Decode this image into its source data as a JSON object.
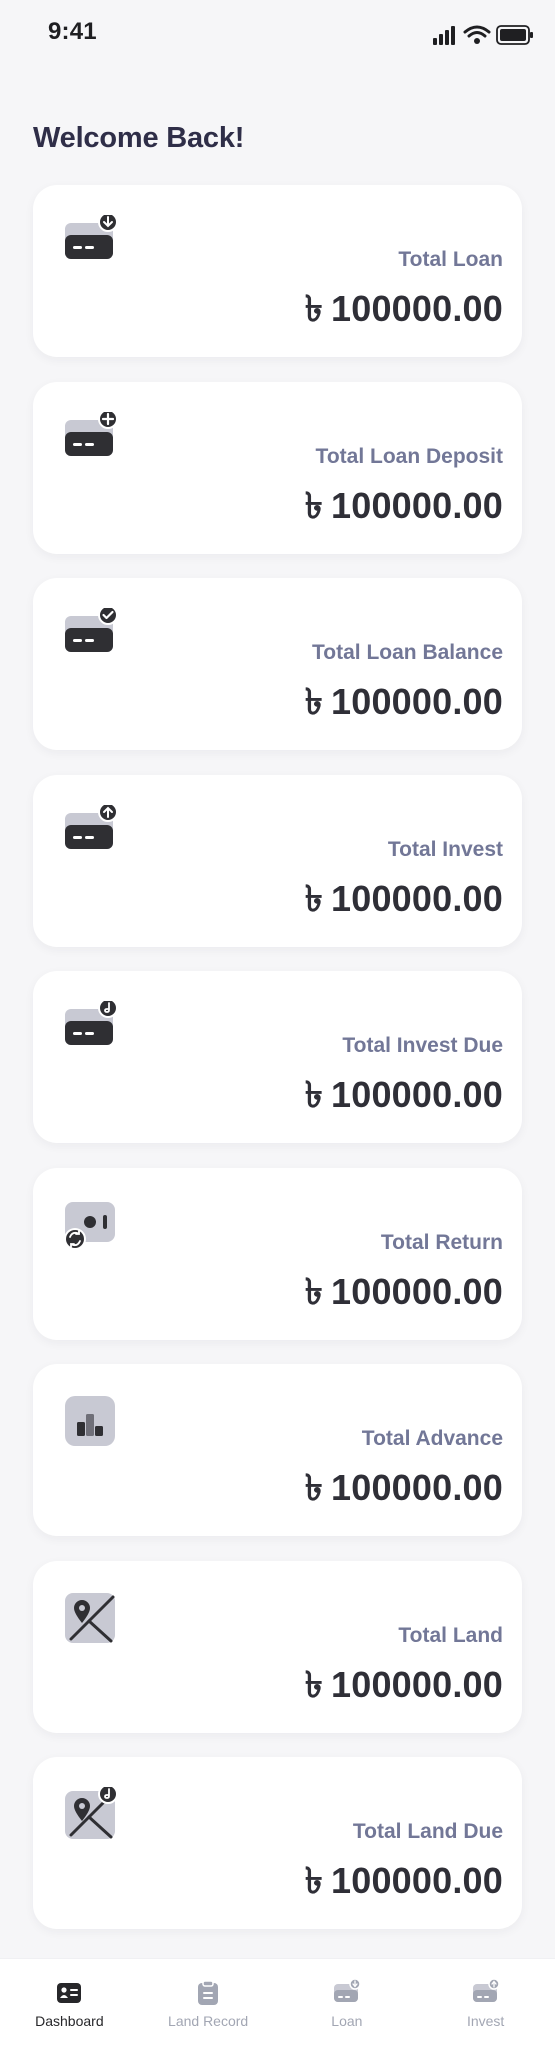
{
  "status_bar": {
    "time": "9:41",
    "icons": [
      "signal-icon",
      "wifi-icon",
      "battery-icon"
    ]
  },
  "page": {
    "title": "Welcome Back!"
  },
  "currency_symbol": "৳",
  "cards": [
    {
      "label": "Total Loan",
      "value": "100000.00",
      "icon": "card-download-icon"
    },
    {
      "label": "Total Loan Deposit",
      "value": "100000.00",
      "icon": "card-add-icon"
    },
    {
      "label": "Total Loan Balance",
      "value": "100000.00",
      "icon": "card-check-icon"
    },
    {
      "label": "Total Invest",
      "value": "100000.00",
      "icon": "card-upload-icon"
    },
    {
      "label": "Total Invest Due",
      "value": "100000.00",
      "icon": "card-due-icon"
    },
    {
      "label": "Total Return",
      "value": "100000.00",
      "icon": "return-icon"
    },
    {
      "label": "Total Advance",
      "value": "100000.00",
      "icon": "advance-chart-icon"
    },
    {
      "label": "Total Land",
      "value": "100000.00",
      "icon": "land-map-icon"
    },
    {
      "label": "Total Land Due",
      "value": "100000.00",
      "icon": "land-due-icon"
    }
  ],
  "bottom_nav": {
    "items": [
      {
        "label": "Dashboard",
        "icon": "dashboard-icon",
        "active": true
      },
      {
        "label": "Land Record",
        "icon": "clipboard-icon",
        "active": false
      },
      {
        "label": "Loan",
        "icon": "loan-card-icon",
        "active": false
      },
      {
        "label": "Invest",
        "icon": "invest-card-icon",
        "active": false
      }
    ]
  },
  "colors": {
    "background": "#f6f6f8",
    "card": "#ffffff",
    "title": "#2f2e48",
    "label": "#727797",
    "value": "#2f2f37",
    "icon_dark": "#2f2f33",
    "icon_light": "#c8c9d3",
    "nav_active": "#27272a",
    "nav_inactive": "#a2a6b3"
  }
}
